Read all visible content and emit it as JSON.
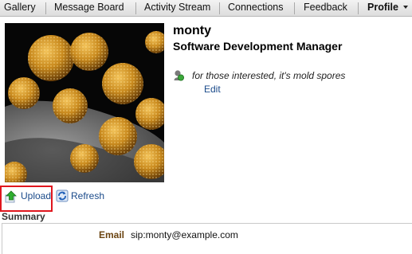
{
  "tabs": [
    {
      "label": "Gallery"
    },
    {
      "label": "Message Board"
    },
    {
      "label": "Activity Stream"
    },
    {
      "label": "Connections"
    },
    {
      "label": "Feedback"
    },
    {
      "label": "Profile",
      "active": true,
      "has_dropdown": true
    }
  ],
  "profile": {
    "name": "monty",
    "title": "Software Development Manager",
    "status_text": "for those interested, it's mold spores",
    "edit_label": "Edit",
    "photo_icon": "mold-spores-photo"
  },
  "photo_actions": {
    "upload_label": "Upload",
    "refresh_label": "Refresh",
    "upload_icon": "upload-arrow-icon",
    "refresh_icon": "refresh-icon"
  },
  "summary": {
    "heading": "Summary",
    "email_label": "Email",
    "email_value": "sip:monty@example.com"
  },
  "colors": {
    "link": "#1a4a8a",
    "highlight_box": "#e0161e",
    "field_label": "#6b4411"
  }
}
